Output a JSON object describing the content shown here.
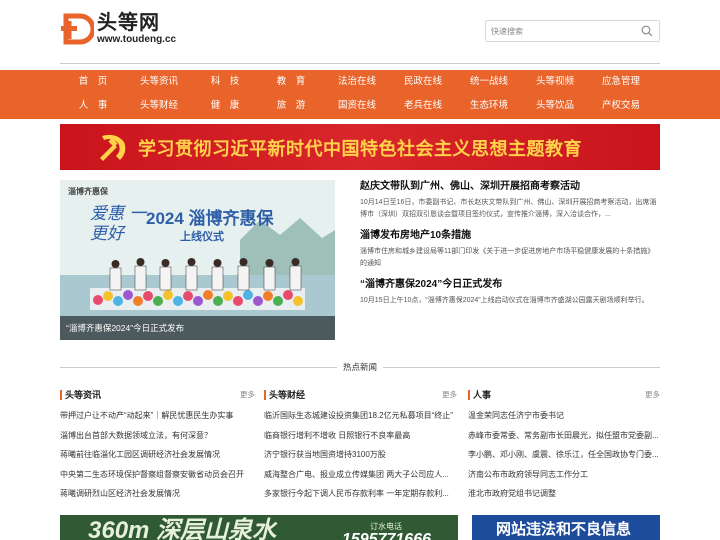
{
  "header": {
    "logo_cn": "头等网",
    "logo_url": "www.toudeng.cc",
    "search_placeholder": "快速搜索"
  },
  "nav": {
    "row1": [
      "首　页",
      "头等资讯",
      "科　技",
      "教　育",
      "法治在线",
      "民政在线",
      "统一战线",
      "头等视频",
      "应急管理"
    ],
    "row2": [
      "人　事",
      "头等财经",
      "健　康",
      "旅　游",
      "国资在线",
      "老兵在线",
      "生态环境",
      "头等饮品",
      "产权交易"
    ]
  },
  "banner": {
    "text": "学习贯彻习近平新时代中国特色社会主义思想主题教育"
  },
  "feature": {
    "caption": "“淄博齐惠保2024”今日正式发布",
    "image_logo": "淄博齐惠保",
    "image_headline": "2024 淄博齐惠保",
    "image_slogan": "爱惠 一更好",
    "image_sub": "上线仪式"
  },
  "news": [
    {
      "title": "赵庆文带队到广州、佛山、深圳开展招商考察活动",
      "desc": "10月14日至16日，市委副书记、市长赵庆文带队到广州、佛山、深圳开展招商考察活动，出席淄博市（深圳）双招双引恳谈会暨项目签约仪式，宣传推介淄博，深入洽谈合作，..."
    },
    {
      "title": "淄博发布房地产10条措施",
      "desc": "淄博市住房和城乡建设局等11部门印发《关于进一步促进房地产市场平稳健康发展的十条措施》的通知"
    },
    {
      "title": "“淄博齐惠保2024”今日正式发布",
      "desc": "10月15日上午10点，“淄博齐惠保2024”上线启动仪式在淄博市齐盛湖公园露天剧场顺利举行。"
    }
  ],
  "hot_news_label": "热点新闻",
  "columns": [
    {
      "title": "头等资讯",
      "more": "更多",
      "items": [
        "带押过户让不动产“动起来”｜解民忧惠民生办实事",
        "淄博出台首部大数据领域立法，有何深意？",
        "蒋曦前往临淄化工园区调研经济社会发展情况",
        "中央第二生态环境保护督察组督察安徽省动员会召开",
        "蒋曦调研烈山区经济社会发展情况"
      ]
    },
    {
      "title": "头等财经",
      "more": "更多",
      "items": [
        "临沂国际生态城建设投资集团18.2亿元私募项目“终止”",
        "临商银行增利不增收 日照银行不良率最高",
        "济宁银行获当地国资增持3100万股",
        "威海整合广电、报业成立传媒集团 两大子公司应人...",
        "多家银行今起下调人民币存款利率 一年定期存款利..."
      ]
    },
    {
      "title": "人事",
      "more": "更多",
      "items": [
        "温金荣同志任济宁市委书记",
        "赤峰市委常委、常务副市长田晨光，拟任盟市党委副...",
        "李小鹏、邓小刚、虞震、徐乐江，任全国政协专门委...",
        "济南公布市政府领导同志工作分工",
        "淮北市政府党组书记调整"
      ]
    }
  ],
  "ads": {
    "left_big": "360m 深层山泉水",
    "left_phone_label": "订水电话",
    "left_phone": "1595771666",
    "right": "网站违法和不良信息"
  },
  "colors": {
    "nav_bg": "#e8642a",
    "banner_bg": "#c9141b",
    "banner_text": "#ffd24a"
  }
}
